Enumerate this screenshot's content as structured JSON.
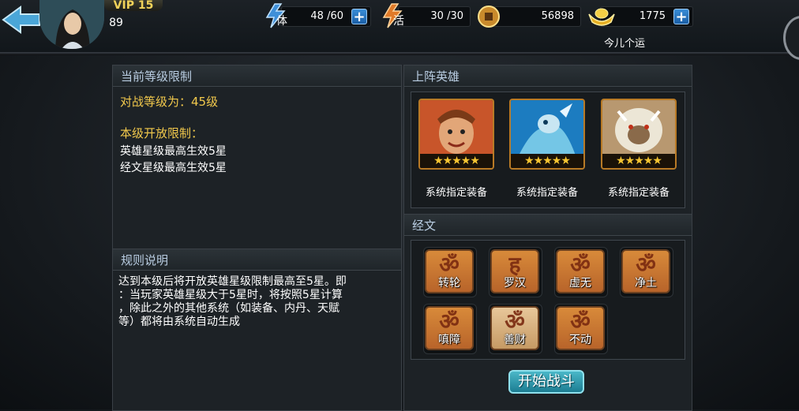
{
  "header": {
    "vip": "VIP 15",
    "level": "89",
    "stamina": {
      "icon_label": "体",
      "value": "48 /60"
    },
    "activity": {
      "icon_label": "活",
      "value": "30 /30"
    },
    "coins": {
      "value": "56898"
    },
    "ingots": {
      "value": "1775"
    },
    "fortune": "今儿个运"
  },
  "limit_panel": {
    "title": "当前等级限制",
    "battle_level": "对战等级为：45级",
    "open_limit_title": "本级开放限制：",
    "lines": [
      "英雄星级最高生效5星",
      "经文星级最高生效5星"
    ]
  },
  "rules_panel": {
    "title": "规则说明",
    "lines": [
      "达到本级后将开放英雄星级限制最高至5星。即",
      "：当玩家英雄星级大于5星时，将按照5星计算",
      "，除此之外的其他系统（如装备、内丹、天赋",
      "等）都将由系统自动生成"
    ]
  },
  "heroes_panel": {
    "title": "上阵英雄",
    "heroes": [
      {
        "stars": "★★★★★",
        "label": "系统指定装备"
      },
      {
        "stars": "★★★★★",
        "label": "系统指定装备"
      },
      {
        "stars": "★★★★★",
        "label": "系统指定装备"
      }
    ]
  },
  "scripture_panel": {
    "title": "经文",
    "items": [
      {
        "glyph": "ॐ",
        "label": "转轮"
      },
      {
        "glyph": "ह",
        "label": "罗汉"
      },
      {
        "glyph": "ॐ",
        "label": "虚无"
      },
      {
        "glyph": "ॐ",
        "label": "净土"
      },
      {
        "glyph": "ॐ",
        "label": "嗔障"
      },
      {
        "glyph": "ॐ",
        "label": "善财"
      },
      {
        "glyph": "ॐ",
        "label": "不动"
      }
    ]
  },
  "start_button": "开始战斗",
  "colors": {
    "gold": "#f2c94c",
    "panel_title": "#b9cde2",
    "button": "#2a9ab0"
  }
}
